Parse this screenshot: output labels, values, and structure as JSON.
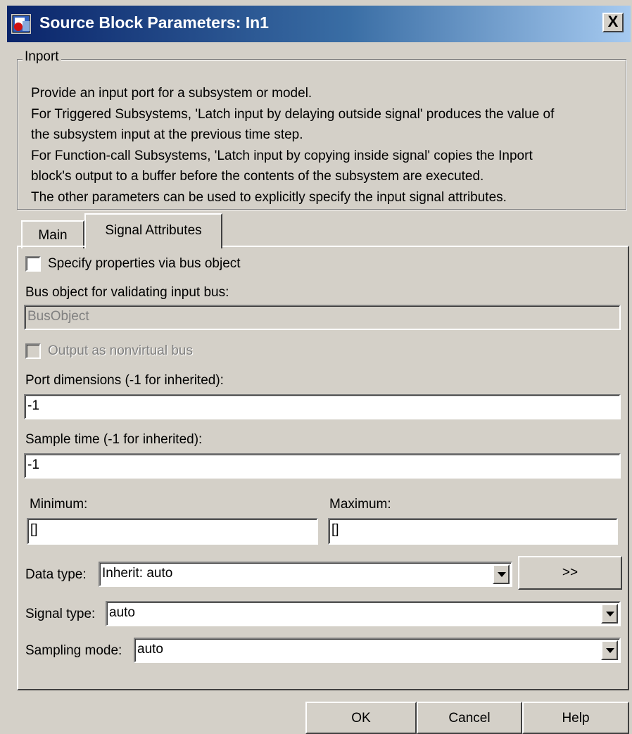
{
  "window": {
    "title": "Source Block Parameters: In1",
    "close_glyph": "X"
  },
  "description": {
    "group_label": "Inport",
    "lines": [
      "Provide an input port for a subsystem or model.",
      "For Triggered Subsystems, 'Latch input by delaying outside signal' produces the value of",
      "the subsystem input at the previous time step.",
      "For Function-call Subsystems, 'Latch input by copying inside signal' copies the Inport",
      "block's output to a buffer before the contents of the subsystem are executed.",
      "The other parameters can be used to explicitly specify the input signal attributes."
    ]
  },
  "tabs": [
    {
      "label": "Main",
      "active": false
    },
    {
      "label": "Signal Attributes",
      "active": true
    }
  ],
  "signal_attributes": {
    "specify_bus_label": "Specify properties via bus object",
    "specify_bus_checked": false,
    "bus_object_label": "Bus object for validating input bus:",
    "bus_object_value": "BusObject",
    "nonvirtual_label": "Output as nonvirtual bus",
    "nonvirtual_checked": false,
    "port_dims_label": "Port dimensions (-1 for inherited):",
    "port_dims_value": "-1",
    "sample_time_label": "Sample time (-1 for inherited):",
    "sample_time_value": "-1",
    "minimum_label": "Minimum:",
    "minimum_value": "[]",
    "maximum_label": "Maximum:",
    "maximum_value": "[]",
    "data_type_label": "Data type:",
    "data_type_value": "Inherit: auto",
    "data_type_assistant_label": ">>",
    "signal_type_label": "Signal type:",
    "signal_type_value": "auto",
    "sampling_mode_label": "Sampling mode:",
    "sampling_mode_value": "auto"
  },
  "buttons": {
    "ok": "OK",
    "cancel": "Cancel",
    "help": "Help"
  },
  "icons": {
    "title_icon": "simulink-block-icon",
    "close": "close-icon",
    "dropdown": "chevron-down-icon"
  }
}
